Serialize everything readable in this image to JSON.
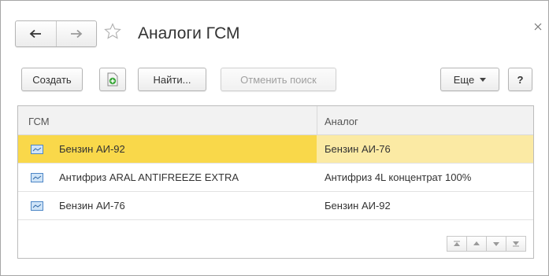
{
  "window": {
    "title": "Аналоги ГСМ"
  },
  "toolbar": {
    "create_label": "Создать",
    "find_label": "Найти...",
    "cancel_search_label": "Отменить поиск",
    "more_label": "Еще",
    "help_label": "?"
  },
  "table": {
    "headers": {
      "col1": "ГСМ",
      "col2": "Аналог"
    },
    "rows": [
      {
        "fuel": "Бензин АИ-92",
        "analog": "Бензин АИ-76",
        "selected": true
      },
      {
        "fuel": "Антифриз ARAL ANTIFREEZE EXTRA",
        "analog": "Антифриз 4L концентрат 100%",
        "selected": false
      },
      {
        "fuel": "Бензин АИ-76",
        "analog": "Бензин АИ-92",
        "selected": false
      }
    ]
  },
  "icons": {
    "back": "back-arrow-icon",
    "forward": "forward-arrow-icon",
    "favorite": "star-icon",
    "close": "close-icon",
    "add_copy": "add-copy-icon",
    "row": "catalog-item-icon",
    "more": "chevron-down-icon",
    "scroll": [
      "scroll-top-icon",
      "scroll-up-icon",
      "scroll-down-icon",
      "scroll-bottom-icon"
    ]
  },
  "colors": {
    "selected_row": "#f9d84a",
    "selected_row_secondary": "#fbeaa4",
    "header_bg": "#f2f2f2"
  }
}
